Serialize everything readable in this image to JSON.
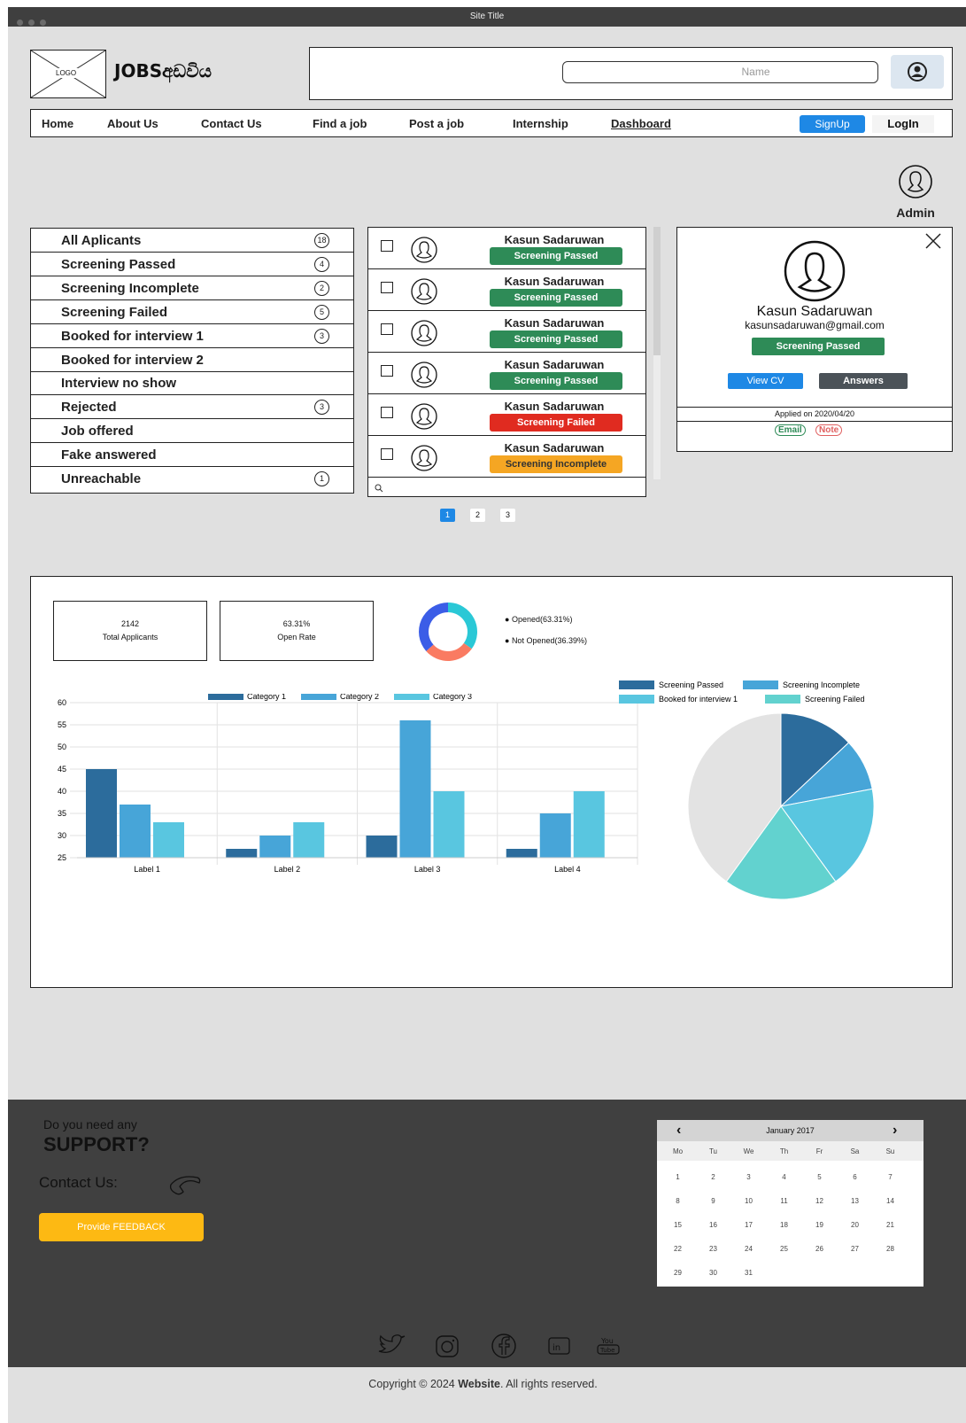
{
  "window": {
    "title": "Site Title"
  },
  "header": {
    "logo_text": "LOGO",
    "brand": "JOBSඅඩවිය",
    "search_placeholder": "Name"
  },
  "nav": {
    "items": [
      "Home",
      "About Us",
      "Contact Us",
      "Find a job",
      "Post a job",
      "Internship",
      "Dashboard"
    ],
    "signup": "SignUp",
    "login": "LogIn"
  },
  "admin": {
    "label": "Admin"
  },
  "filters": [
    {
      "label": "All Aplicants",
      "count": "18"
    },
    {
      "label": "Screening Passed",
      "count": "4"
    },
    {
      "label": "Screening Incomplete",
      "count": "2"
    },
    {
      "label": "Screening Failed",
      "count": "5"
    },
    {
      "label": "Booked for interview 1",
      "count": "3"
    },
    {
      "label": "Booked for interview 2",
      "count": ""
    },
    {
      "label": "Interview no show",
      "count": ""
    },
    {
      "label": "Rejected",
      "count": "3"
    },
    {
      "label": "Job offered",
      "count": ""
    },
    {
      "label": "Fake answered",
      "count": ""
    },
    {
      "label": "Unreachable",
      "count": "1"
    }
  ],
  "applicants": [
    {
      "name": "Kasun Sadaruwan",
      "status": "Screening Passed"
    },
    {
      "name": "Kasun Sadaruwan",
      "status": "Screening Passed"
    },
    {
      "name": "Kasun Sadaruwan",
      "status": "Screening Passed"
    },
    {
      "name": "Kasun Sadaruwan",
      "status": "Screening Passed"
    },
    {
      "name": "Kasun Sadaruwan",
      "status": "Screening Failed"
    },
    {
      "name": "Kasun Sadaruwan",
      "status": "Screening Incomplete"
    }
  ],
  "status_colors": {
    "Screening Passed": "#2e8b57",
    "Screening Failed": "#e02b20",
    "Screening Incomplete": "#f5a623"
  },
  "pagination": [
    "1",
    "2",
    "3"
  ],
  "detail": {
    "name": "Kasun Sadaruwan",
    "email": "kasunsadaruwan@gmail.com",
    "status": "Screening Passed",
    "view_cv": "View CV",
    "answers": "Answers",
    "applied": "Applied on 2020/04/20",
    "email_btn": "Email",
    "note_btn": "Note"
  },
  "stats": {
    "total_value": "2142",
    "total_label": "Total Applicants",
    "open_value": "63.31%",
    "open_label": "Open Rate",
    "legend_opened": "Opened(63.31%)",
    "legend_not_opened": "Not Opened(36.39%)"
  },
  "chart_data": [
    {
      "type": "pie",
      "variant": "donut",
      "labels": [
        "Opened",
        "Not Opened"
      ],
      "values": [
        63.31,
        36.39
      ],
      "colors": [
        "#2ac8d6",
        "#fa7b62",
        "#3b5de7"
      ]
    },
    {
      "type": "bar",
      "categories": [
        "Label 1",
        "Label 2",
        "Label 3",
        "Label 4"
      ],
      "series": [
        {
          "name": "Category 1",
          "values": [
            45,
            27,
            30,
            27
          ],
          "color": "#2c6c9c"
        },
        {
          "name": "Category 2",
          "values": [
            37,
            30,
            56,
            35
          ],
          "color": "#47a5d8"
        },
        {
          "name": "Category 3",
          "values": [
            33,
            33,
            40,
            40
          ],
          "color": "#59c6e0"
        }
      ],
      "ylim": [
        25,
        60
      ],
      "yticks": [
        25,
        30,
        35,
        40,
        45,
        50,
        55,
        60
      ],
      "grid": true,
      "legend": "top"
    },
    {
      "type": "pie",
      "labels": [
        "Screening Passed",
        "Screening Incomplete",
        "Booked for interview 1",
        "Screening Failed",
        ""
      ],
      "values": [
        13,
        9,
        18,
        20,
        40
      ],
      "colors": [
        "#2c6c9c",
        "#47a5d8",
        "#59c6e0",
        "#62d2cf",
        "#e3e3e3"
      ],
      "legend": "top"
    }
  ],
  "footer": {
    "q1": "Do you need any",
    "q2": "SUPPORT?",
    "contact": "Contact Us:",
    "feedback": "Provide FEEDBACK",
    "copyright_pre": "Copyright © 2024 ",
    "copyright_site": "Website",
    "copyright_post": ". All rights reserved."
  },
  "calendar": {
    "month": "January 2017",
    "days": [
      "Mo",
      "Tu",
      "We",
      "Th",
      "Fr",
      "Sa",
      "Su"
    ],
    "weeks": [
      [
        "1",
        "2",
        "3",
        "4",
        "5",
        "6",
        "7"
      ],
      [
        "8",
        "9",
        "10",
        "11",
        "12",
        "13",
        "14"
      ],
      [
        "15",
        "16",
        "17",
        "18",
        "19",
        "20",
        "21"
      ],
      [
        "22",
        "23",
        "24",
        "25",
        "26",
        "27",
        "28"
      ],
      [
        "29",
        "30",
        "31",
        "",
        "",
        "",
        ""
      ]
    ]
  }
}
